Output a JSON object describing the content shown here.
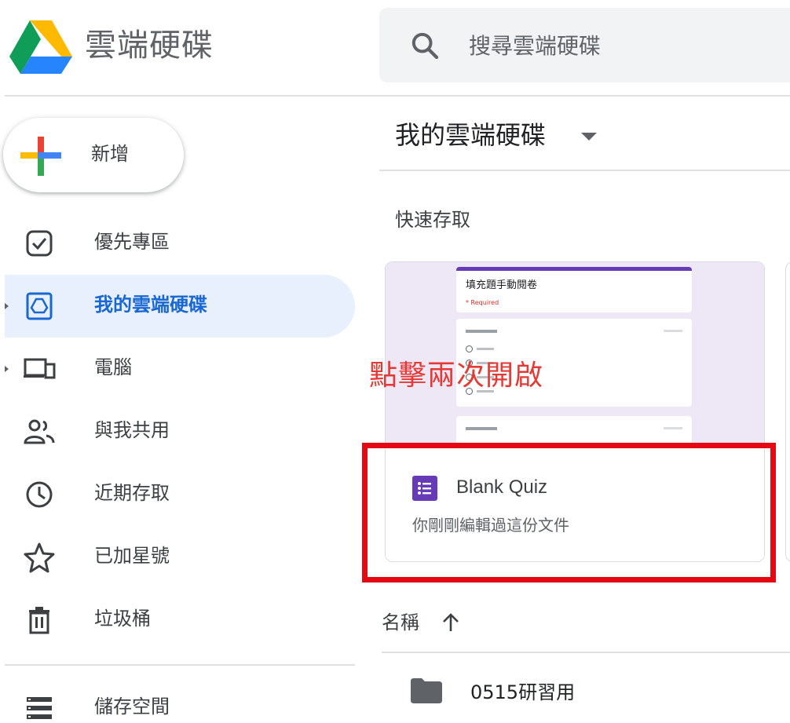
{
  "app": {
    "title": "雲端硬碟"
  },
  "search": {
    "placeholder": "搜尋雲端硬碟"
  },
  "new_button": {
    "label": "新增"
  },
  "sidebar": {
    "items": [
      {
        "id": "priority",
        "label": "優先專區",
        "icon": "priority-icon"
      },
      {
        "id": "my-drive",
        "label": "我的雲端硬碟",
        "icon": "drive-icon",
        "active": true
      },
      {
        "id": "computers",
        "label": "電腦",
        "icon": "computer-icon"
      },
      {
        "id": "shared",
        "label": "與我共用",
        "icon": "people-icon"
      },
      {
        "id": "recent",
        "label": "近期存取",
        "icon": "clock-icon"
      },
      {
        "id": "starred",
        "label": "已加星號",
        "icon": "star-icon"
      },
      {
        "id": "trash",
        "label": "垃圾桶",
        "icon": "trash-icon"
      },
      {
        "id": "storage",
        "label": "儲存空間",
        "icon": "storage-icon"
      }
    ]
  },
  "main": {
    "title": "我的雲端硬碟",
    "quick_access": {
      "heading": "快速存取",
      "card": {
        "thumbnail_title": "填充題手動閱卷",
        "thumbnail_required": "* Required",
        "name": "Blank Quiz",
        "subtitle": "你剛剛編輯過這份文件",
        "icon": "forms-icon"
      }
    },
    "annotation": {
      "text": "點擊兩次開啟"
    },
    "sort": {
      "label": "名稱",
      "direction_icon": "arrow-up-icon"
    },
    "files": [
      {
        "name": "0515研習用",
        "icon": "folder-icon"
      }
    ]
  },
  "colors": {
    "accent": "#1967d2",
    "active_bg": "#e8f0fe",
    "forms_purple": "#673ab7",
    "annotation_red": "#e50914"
  }
}
